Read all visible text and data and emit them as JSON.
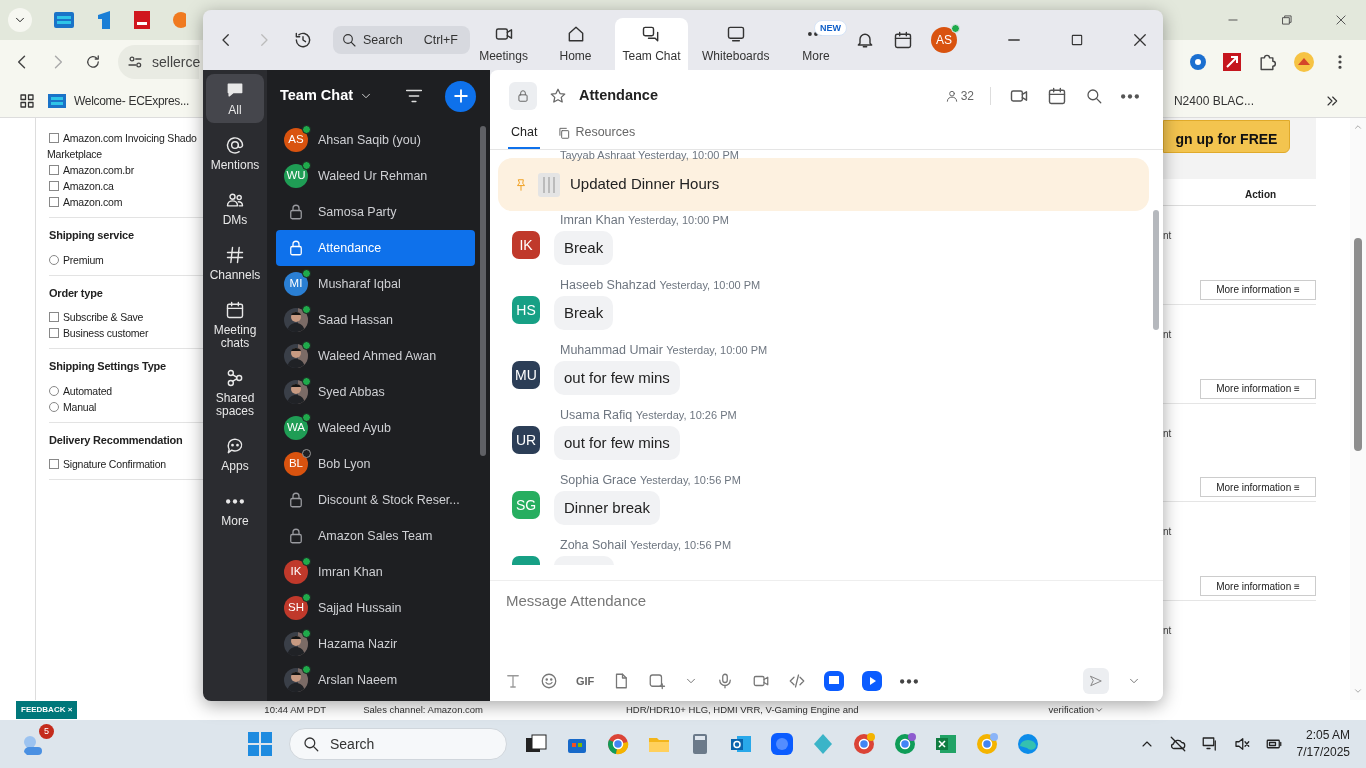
{
  "browser": {
    "address": "sellerce",
    "bookmarks": [
      {
        "label": "Welcome- ECExpres..."
      },
      {
        "label": "N2400 BLAC..."
      }
    ],
    "filter_groups": [
      {
        "items": [
          {
            "kind": "checkbox",
            "label": "Amazon.com Invoicing Shado",
            "wrapped": "Marketplace",
            "checked": false
          },
          {
            "kind": "checkbox",
            "label": "Amazon.com.br",
            "checked": false
          },
          {
            "kind": "checkbox",
            "label": "Amazon.ca",
            "checked": false
          },
          {
            "kind": "checkbox",
            "label": "Amazon.com",
            "checked": false
          }
        ]
      },
      {
        "title": "Shipping service",
        "items": [
          {
            "kind": "radio",
            "label": "Premium",
            "checked": false
          }
        ]
      },
      {
        "title": "Order type",
        "items": [
          {
            "kind": "checkbox",
            "label": "Subscribe & Save",
            "checked": false
          },
          {
            "kind": "checkbox",
            "label": "Business customer",
            "checked": false
          }
        ]
      },
      {
        "title": "Shipping Settings Type",
        "items": [
          {
            "kind": "radio",
            "label": "Automated",
            "checked": false
          },
          {
            "kind": "radio",
            "label": "Manual",
            "checked": false
          }
        ]
      },
      {
        "title": "Delivery Recommendation",
        "items": [
          {
            "kind": "checkbox",
            "label": "Signature Confirmation",
            "checked": false
          }
        ]
      }
    ],
    "signup_button": "gn up for FREE",
    "action_header": "Action",
    "rows": [
      {
        "fragment": "nt",
        "button": "More information ≡"
      },
      {
        "fragment": "nt",
        "button": "More information ≡"
      },
      {
        "fragment": "nt",
        "button": "More information ≡"
      },
      {
        "fragment": "nt",
        "button": "More information ≡"
      },
      {
        "fragment": "nt"
      }
    ],
    "footer": [
      "10:44 AM PDT",
      "Sales channel: Amazon.com",
      "HDR/HDR10+ HLG, HDMI VRR, V-Gaming Engine and",
      "verification"
    ],
    "feedback": "FEEDBACK",
    "feedback_close": "×"
  },
  "zoom": {
    "search": {
      "placeholder": "Search",
      "shortcut": "Ctrl+F"
    },
    "tabs": [
      {
        "label": "Meetings",
        "kind": "video",
        "selected": false
      },
      {
        "label": "Home",
        "kind": "home",
        "selected": false
      },
      {
        "label": "Team Chat",
        "kind": "chat",
        "selected": true
      },
      {
        "label": "Whiteboards",
        "kind": "board",
        "selected": false
      },
      {
        "label": "More",
        "kind": "more",
        "badge": "NEW",
        "selected": false
      }
    ],
    "account": {
      "initials": "AS",
      "color": "#d9530f",
      "online": true
    },
    "rail": [
      {
        "label": "All",
        "kind": "all",
        "selected": true
      },
      {
        "label": "Mentions",
        "kind": "at",
        "selected": false
      },
      {
        "label": "DMs",
        "kind": "people",
        "selected": false
      },
      {
        "label": "Channels",
        "kind": "hash",
        "selected": false
      },
      {
        "label": "Meeting chats",
        "kind": "calendar",
        "selected": false
      },
      {
        "label": "Shared spaces",
        "kind": "spaces",
        "selected": false
      },
      {
        "label": "Apps",
        "kind": "apps",
        "selected": false
      },
      {
        "label": "More",
        "kind": "more",
        "selected": false
      }
    ],
    "list": {
      "title": "Team Chat",
      "items": [
        {
          "kind": "person",
          "initials": "AS",
          "color": "#d9530f",
          "name": "Ahsan Saqib (you)",
          "online": true,
          "selected": false
        },
        {
          "kind": "person",
          "initials": "WU",
          "color": "#1f9d55",
          "name": "Waleed Ur Rehman",
          "online": true,
          "selected": false
        },
        {
          "kind": "channel",
          "name": "Samosa Party",
          "selected": false
        },
        {
          "kind": "channel",
          "name": "Attendance",
          "selected": true
        },
        {
          "kind": "person",
          "initials": "MI",
          "color": "#2a7fd4",
          "name": "Musharaf Iqbal",
          "online": true,
          "selected": false
        },
        {
          "name": "Saad Hassan",
          "online": true,
          "selected": false
        },
        {
          "name": "Waleed Ahmed Awan",
          "online": true,
          "selected": false
        },
        {
          "name": "Syed Abbas",
          "online": true,
          "selected": false
        },
        {
          "kind": "person",
          "initials": "WA",
          "color": "#1f9d55",
          "name": "Waleed Ayub",
          "online": true,
          "selected": false
        },
        {
          "kind": "person",
          "initials": "BL",
          "color": "#d9530f",
          "name": "Bob Lyon",
          "online": false,
          "selected": false
        },
        {
          "kind": "channel",
          "name": "Discount & Stock Reser...",
          "selected": false
        },
        {
          "kind": "channel",
          "name": "Amazon Sales Team",
          "selected": false
        },
        {
          "kind": "person",
          "initials": "IK",
          "color": "#c0392b",
          "name": "Imran Khan",
          "online": true,
          "selected": false
        },
        {
          "kind": "person",
          "initials": "SH",
          "color": "#c0392b",
          "name": "Sajjad Hussain",
          "online": true,
          "selected": false
        },
        {
          "name": "Hazama Nazir",
          "online": true,
          "selected": false
        },
        {
          "name": "Arslan Naeem",
          "online": true,
          "selected": false
        }
      ]
    },
    "channel": {
      "name": "Attendance",
      "members": "32",
      "tabs": [
        {
          "label": "Chat",
          "selected": true
        },
        {
          "label": "Resources",
          "selected": false
        }
      ],
      "pinned": "Updated Dinner Hours",
      "messages": [
        {
          "sender": "Tayyab Ashraat",
          "time": "Yesterday, 10:00 PM"
        },
        {
          "sender": "Imran Khan",
          "time": "Yesterday, 10:00 PM",
          "initials": "IK",
          "color": "#c0392b",
          "text": "Break"
        },
        {
          "sender": "Haseeb Shahzad",
          "time": "Yesterday, 10:00 PM",
          "initials": "HS",
          "color": "#17a085",
          "text": "Break"
        },
        {
          "sender": "Muhammad Umair",
          "time": "Yesterday, 10:00 PM",
          "initials": "MU",
          "color": "#2c3e57",
          "text": "out for few mins"
        },
        {
          "sender": "Usama Rafiq",
          "time": "Yesterday, 10:26 PM",
          "initials": "UR",
          "color": "#2c3e57",
          "text": "out for few mins"
        },
        {
          "sender": "Sophia Grace",
          "time": "Yesterday, 10:56 PM",
          "initials": "SG",
          "color": "#27ae60",
          "text": "Dinner break"
        },
        {
          "sender": "Zoha Sohail",
          "time": "Yesterday, 10:56 PM",
          "color": "#17a085"
        }
      ],
      "composer": {
        "placeholder": "Message Attendance"
      },
      "gif": "GIF"
    }
  },
  "taskbar": {
    "notification_count": "5",
    "search": "Search",
    "time": "2:05 AM",
    "date": "7/17/2025"
  }
}
